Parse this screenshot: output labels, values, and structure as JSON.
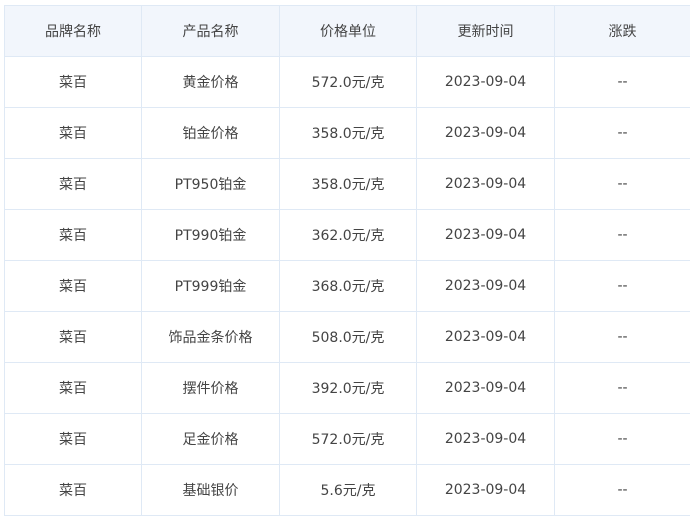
{
  "table": {
    "headers": [
      "品牌名称",
      "产品名称",
      "价格单位",
      "更新时间",
      "涨跌"
    ],
    "rows": [
      {
        "brand": "菜百",
        "product": "黄金价格",
        "price": "572.0元/克",
        "date": "2023-09-04",
        "change": "--"
      },
      {
        "brand": "菜百",
        "product": "铂金价格",
        "price": "358.0元/克",
        "date": "2023-09-04",
        "change": "--"
      },
      {
        "brand": "菜百",
        "product": "PT950铂金",
        "price": "358.0元/克",
        "date": "2023-09-04",
        "change": "--"
      },
      {
        "brand": "菜百",
        "product": "PT990铂金",
        "price": "362.0元/克",
        "date": "2023-09-04",
        "change": "--"
      },
      {
        "brand": "菜百",
        "product": "PT999铂金",
        "price": "368.0元/克",
        "date": "2023-09-04",
        "change": "--"
      },
      {
        "brand": "菜百",
        "product": "饰品金条价格",
        "price": "508.0元/克",
        "date": "2023-09-04",
        "change": "--"
      },
      {
        "brand": "菜百",
        "product": "摆件价格",
        "price": "392.0元/克",
        "date": "2023-09-04",
        "change": "--"
      },
      {
        "brand": "菜百",
        "product": "足金价格",
        "price": "572.0元/克",
        "date": "2023-09-04",
        "change": "--"
      },
      {
        "brand": "菜百",
        "product": "基础银价",
        "price": "5.6元/克",
        "date": "2023-09-04",
        "change": "--"
      }
    ]
  },
  "colors": {
    "header_bg": "#f2f6fc",
    "border": "#dfe9f5",
    "text": "#444444"
  }
}
